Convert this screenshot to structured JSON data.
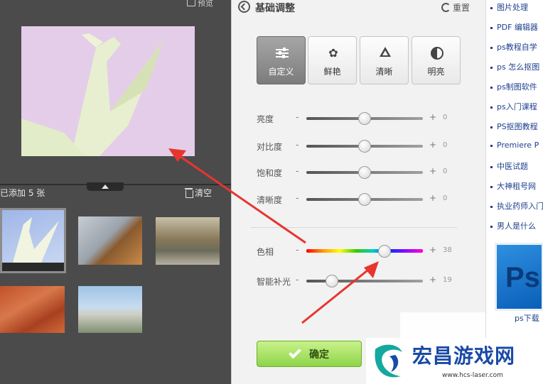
{
  "left": {
    "preview_label": "预览",
    "added_count": "已添加 5 张",
    "clear_label": "清空"
  },
  "panel": {
    "title": "基础调整",
    "reset_label": "重置",
    "modes": [
      {
        "label": "自定义",
        "icon": "sliders-icon",
        "active": true
      },
      {
        "label": "鲜艳",
        "icon": "flower-icon",
        "active": false
      },
      {
        "label": "清晰",
        "icon": "triangle-icon",
        "active": false
      },
      {
        "label": "明亮",
        "icon": "half-circle-icon",
        "active": false
      }
    ],
    "sliders": [
      {
        "label": "亮度",
        "minus": "-",
        "plus": "+",
        "value": "0",
        "level": 0.5
      },
      {
        "label": "对比度",
        "minus": "-",
        "plus": "+",
        "value": "0",
        "level": 0.5
      },
      {
        "label": "饱和度",
        "minus": "-",
        "plus": "+",
        "value": "0",
        "level": 0.5
      },
      {
        "label": "清晰度",
        "minus": "-",
        "plus": "+",
        "value": "0",
        "level": 0.5
      },
      {
        "label": "色相",
        "minus": "-",
        "plus": "+",
        "value": "38",
        "level": 0.67
      },
      {
        "label": "智能补光",
        "minus": "-",
        "plus": "+",
        "value": "19",
        "level": 0.22
      }
    ],
    "confirm_label": "确定"
  },
  "sidebar": {
    "links": [
      "图片处理",
      "PDF 编辑器",
      "ps教程自学",
      "ps 怎么抠图",
      "ps制图软件",
      "ps入门课程",
      "PS抠图教程",
      "Premiere P",
      "中医试题",
      "大神租号网",
      "执业药师入门",
      "男人是什么"
    ],
    "ad_text": "Ps",
    "ad_caption": "ps下载"
  },
  "watermark": {
    "brand": "宏昌游戏网",
    "url": "www.hcs-laser.com"
  },
  "colors": {
    "confirm_green": "#8fd44a",
    "active_mode": "#8c8c8c",
    "link_blue": "#1f3f8f",
    "arrow_red": "#e8352f"
  }
}
